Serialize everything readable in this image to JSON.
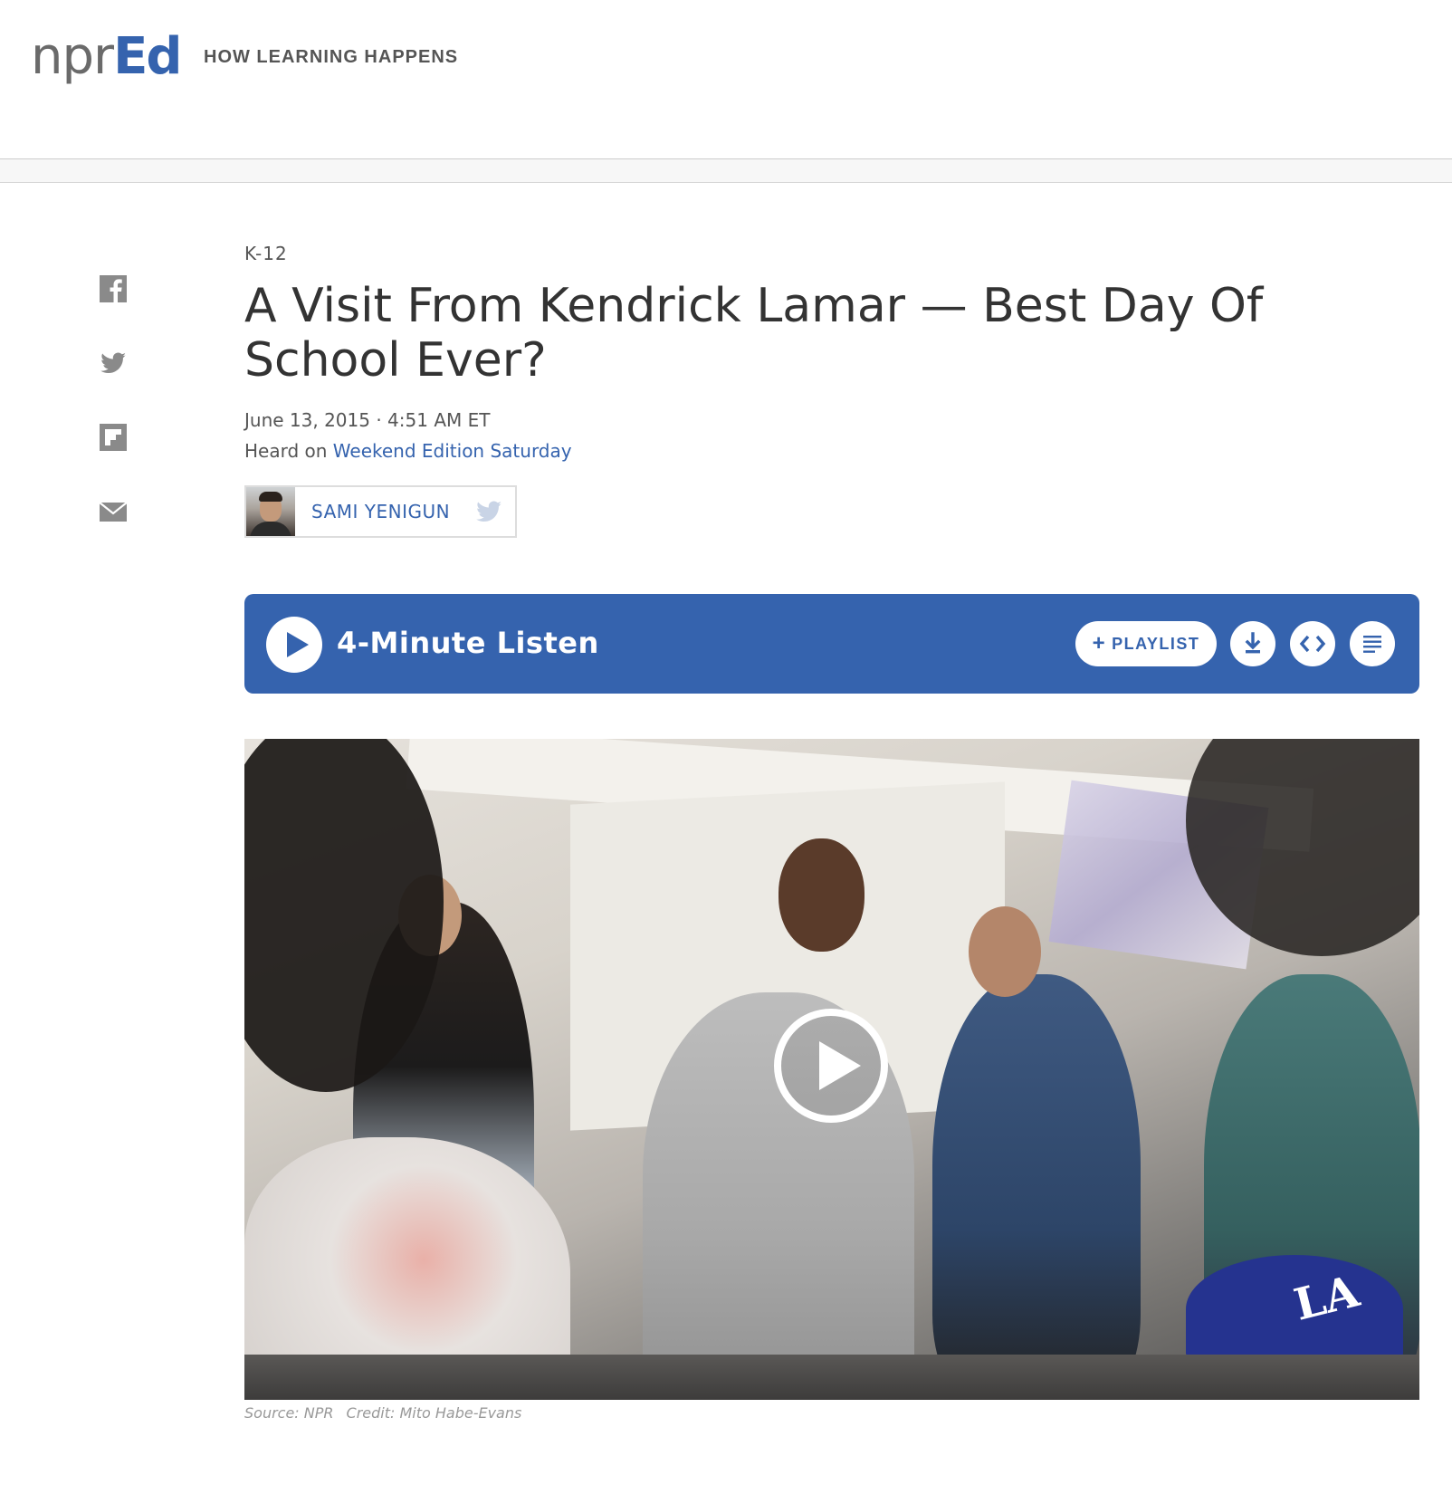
{
  "header": {
    "logo_npr": "npr",
    "logo_ed": "Ed",
    "tagline": "HOW LEARNING HAPPENS"
  },
  "share": {
    "items": [
      {
        "name": "facebook-icon"
      },
      {
        "name": "twitter-icon"
      },
      {
        "name": "flipboard-icon"
      },
      {
        "name": "email-icon"
      }
    ]
  },
  "article": {
    "slug": "K-12",
    "headline": "A Visit From Kendrick Lamar — Best Day Of School Ever?",
    "date": "June 13, 2015 · 4:51 AM ET",
    "heard_prefix": "Heard on ",
    "heard_program": "Weekend Edition Saturday",
    "author": "SAMI YENIGUN"
  },
  "audio": {
    "listen_label": "4-Minute Listen",
    "playlist_label": "PLAYLIST",
    "icons": [
      "play-icon",
      "plus-icon",
      "download-icon",
      "embed-icon",
      "transcript-icon"
    ]
  },
  "photo": {
    "cap_logo": "LA",
    "source": "Source: NPR",
    "credit": "Credit: Mito Habe-Evans"
  },
  "colors": {
    "accent": "#3563ae",
    "icon_gray": "#8a8a8a"
  }
}
